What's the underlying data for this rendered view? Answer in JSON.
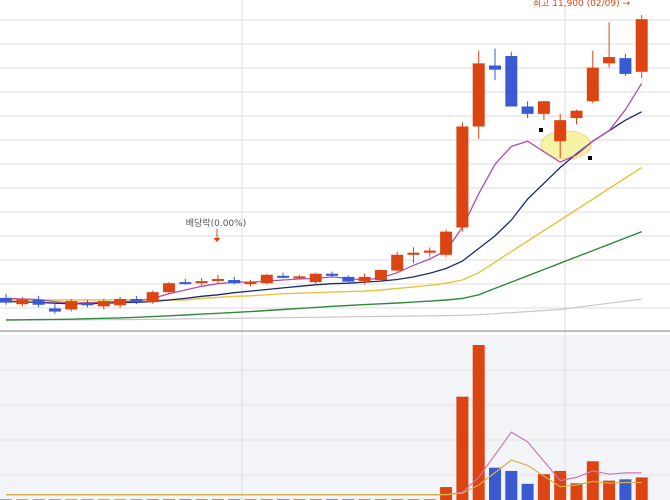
{
  "chart_data": {
    "type": "candlestick",
    "annotations": {
      "dividend": "배당락(0.00%)",
      "high": "최고 11,900 (02/09) →"
    },
    "colors": {
      "up": "#dc4412",
      "down": "#3a5ad2",
      "ma5": "#b14db6",
      "ma10": "#1c2a6e",
      "ma20": "#e8c33a",
      "ma60": "#2f8a3a",
      "ma120": "#c8c8c8",
      "volume_ma": "#c97ab6",
      "highlight": "#f6f2a6",
      "grid": "#dddddd",
      "separator": "#a9a9a9",
      "volume_bg": "#f3f4f7"
    },
    "price_axis": {
      "min": 0,
      "max": 12000
    },
    "volume_axis": {
      "min": 0,
      "max": 3000
    },
    "candles": [
      {
        "o": 9210,
        "h": 9250,
        "l": 9145,
        "c": 9165,
        "v": 8
      },
      {
        "o": 9150,
        "h": 9220,
        "l": 9130,
        "c": 9195,
        "v": 8
      },
      {
        "o": 9190,
        "h": 9230,
        "l": 9120,
        "c": 9145,
        "v": 8
      },
      {
        "o": 9110,
        "h": 9160,
        "l": 9060,
        "c": 9080,
        "v": 8
      },
      {
        "o": 9100,
        "h": 9200,
        "l": 9080,
        "c": 9180,
        "v": 8
      },
      {
        "o": 9160,
        "h": 9190,
        "l": 9120,
        "c": 9140,
        "v": 8
      },
      {
        "o": 9130,
        "h": 9200,
        "l": 9100,
        "c": 9180,
        "v": 8
      },
      {
        "o": 9140,
        "h": 9220,
        "l": 9115,
        "c": 9200,
        "v": 8
      },
      {
        "o": 9200,
        "h": 9230,
        "l": 9150,
        "c": 9170,
        "v": 8
      },
      {
        "o": 9170,
        "h": 9280,
        "l": 9155,
        "c": 9265,
        "v": 10
      },
      {
        "o": 9265,
        "h": 9360,
        "l": 9250,
        "c": 9350,
        "v": 10
      },
      {
        "o": 9360,
        "h": 9390,
        "l": 9335,
        "c": 9350,
        "v": 10
      },
      {
        "o": 9350,
        "h": 9400,
        "l": 9330,
        "c": 9370,
        "v": 10
      },
      {
        "o": 9375,
        "h": 9430,
        "l": 9350,
        "c": 9390,
        "v": 10
      },
      {
        "o": 9380,
        "h": 9410,
        "l": 9340,
        "c": 9350,
        "v": 10
      },
      {
        "o": 9345,
        "h": 9380,
        "l": 9320,
        "c": 9360,
        "v": 10
      },
      {
        "o": 9350,
        "h": 9440,
        "l": 9340,
        "c": 9430,
        "v": 10
      },
      {
        "o": 9420,
        "h": 9450,
        "l": 9395,
        "c": 9405,
        "v": 10
      },
      {
        "o": 9400,
        "h": 9430,
        "l": 9390,
        "c": 9415,
        "v": 10
      },
      {
        "o": 9360,
        "h": 9450,
        "l": 9330,
        "c": 9440,
        "v": 10
      },
      {
        "o": 9440,
        "h": 9460,
        "l": 9405,
        "c": 9420,
        "v": 10
      },
      {
        "o": 9410,
        "h": 9420,
        "l": 9345,
        "c": 9365,
        "v": 10
      },
      {
        "o": 9370,
        "h": 9440,
        "l": 9340,
        "c": 9410,
        "v": 10
      },
      {
        "o": 9380,
        "h": 9480,
        "l": 9370,
        "c": 9475,
        "v": 10
      },
      {
        "o": 9470,
        "h": 9650,
        "l": 9460,
        "c": 9620,
        "v": 10
      },
      {
        "o": 9620,
        "h": 9690,
        "l": 9540,
        "c": 9640,
        "v": 10
      },
      {
        "o": 9640,
        "h": 9690,
        "l": 9600,
        "c": 9660,
        "v": 10
      },
      {
        "o": 9620,
        "h": 9860,
        "l": 9600,
        "c": 9840,
        "v": 200
      },
      {
        "o": 9880,
        "h": 10880,
        "l": 9840,
        "c": 10840,
        "v": 1600
      },
      {
        "o": 10840,
        "h": 11560,
        "l": 10720,
        "c": 11440,
        "v": 2400
      },
      {
        "o": 11420,
        "h": 11580,
        "l": 11280,
        "c": 11380,
        "v": 500
      },
      {
        "o": 11510,
        "h": 11550,
        "l": 11030,
        "c": 11030,
        "v": 450
      },
      {
        "o": 11030,
        "h": 11080,
        "l": 10920,
        "c": 10960,
        "v": 250
      },
      {
        "o": 10960,
        "h": 11080,
        "l": 10900,
        "c": 11080,
        "v": 400
      },
      {
        "o": 10700,
        "h": 10960,
        "l": 10540,
        "c": 10900,
        "v": 450
      },
      {
        "o": 10920,
        "h": 11000,
        "l": 10860,
        "c": 10990,
        "v": 260
      },
      {
        "o": 11080,
        "h": 11560,
        "l": 11060,
        "c": 11400,
        "v": 600
      },
      {
        "o": 11440,
        "h": 11830,
        "l": 11400,
        "c": 11500,
        "v": 300
      },
      {
        "o": 11490,
        "h": 11530,
        "l": 11320,
        "c": 11340,
        "v": 320
      },
      {
        "o": 11360,
        "h": 11900,
        "l": 11300,
        "c": 11860,
        "v": 350
      }
    ],
    "moving_averages": {
      "ma5": [
        9205,
        9200,
        9195,
        9175,
        9160,
        9165,
        9170,
        9175,
        9180,
        9205,
        9250,
        9285,
        9320,
        9345,
        9360,
        9360,
        9370,
        9380,
        9390,
        9395,
        9410,
        9395,
        9380,
        9400,
        9450,
        9520,
        9580,
        9660,
        9880,
        10200,
        10480,
        10650,
        10700,
        10600,
        10500,
        10570,
        10700,
        10800,
        11000,
        11250
      ],
      "ma10": [
        9175,
        9172,
        9168,
        9160,
        9155,
        9155,
        9160,
        9165,
        9168,
        9175,
        9190,
        9205,
        9225,
        9240,
        9260,
        9275,
        9290,
        9305,
        9320,
        9335,
        9345,
        9350,
        9360,
        9370,
        9385,
        9410,
        9445,
        9490,
        9560,
        9680,
        9800,
        9950,
        10150,
        10300,
        10450,
        10580,
        10700,
        10800,
        10900,
        10980
      ],
      "ma20": [
        9190,
        9190,
        9190,
        9190,
        9190,
        9190,
        9190,
        9190,
        9190,
        9190,
        9190,
        9190,
        9205,
        9215,
        9225,
        9230,
        9240,
        9250,
        9255,
        9260,
        9265,
        9270,
        9275,
        9285,
        9300,
        9315,
        9330,
        9350,
        9380,
        9450,
        9550,
        9650,
        9750,
        9850,
        9950,
        10050,
        10150,
        10250,
        10350,
        10450
      ],
      "ma60": [
        9000,
        9002,
        9004,
        9006,
        9008,
        9012,
        9016,
        9020,
        9026,
        9032,
        9040,
        9048,
        9056,
        9064,
        9072,
        9080,
        9090,
        9100,
        9110,
        9120,
        9130,
        9138,
        9146,
        9154,
        9162,
        9170,
        9180,
        9190,
        9205,
        9240,
        9300,
        9360,
        9420,
        9480,
        9540,
        9600,
        9660,
        9720,
        9780,
        9840
      ],
      "ma120": [
        9000,
        9000,
        9000,
        9001,
        9001,
        9002,
        9003,
        9004,
        9005,
        9006,
        9008,
        9010,
        9012,
        9014,
        9016,
        9018,
        9020,
        9022,
        9024,
        9026,
        9028,
        9030,
        9032,
        9034,
        9036,
        9038,
        9040,
        9042,
        9045,
        9050,
        9060,
        9070,
        9080,
        9090,
        9100,
        9120,
        9140,
        9160,
        9180,
        9200
      ]
    },
    "volume_ma": [
      80,
      80,
      80,
      80,
      80,
      80,
      80,
      80,
      80,
      80,
      80,
      80,
      80,
      80,
      80,
      80,
      80,
      80,
      80,
      80,
      80,
      80,
      80,
      80,
      80,
      80,
      80,
      80,
      120,
      350,
      700,
      1050,
      900,
      600,
      300,
      350,
      450,
      400,
      420,
      420
    ]
  }
}
